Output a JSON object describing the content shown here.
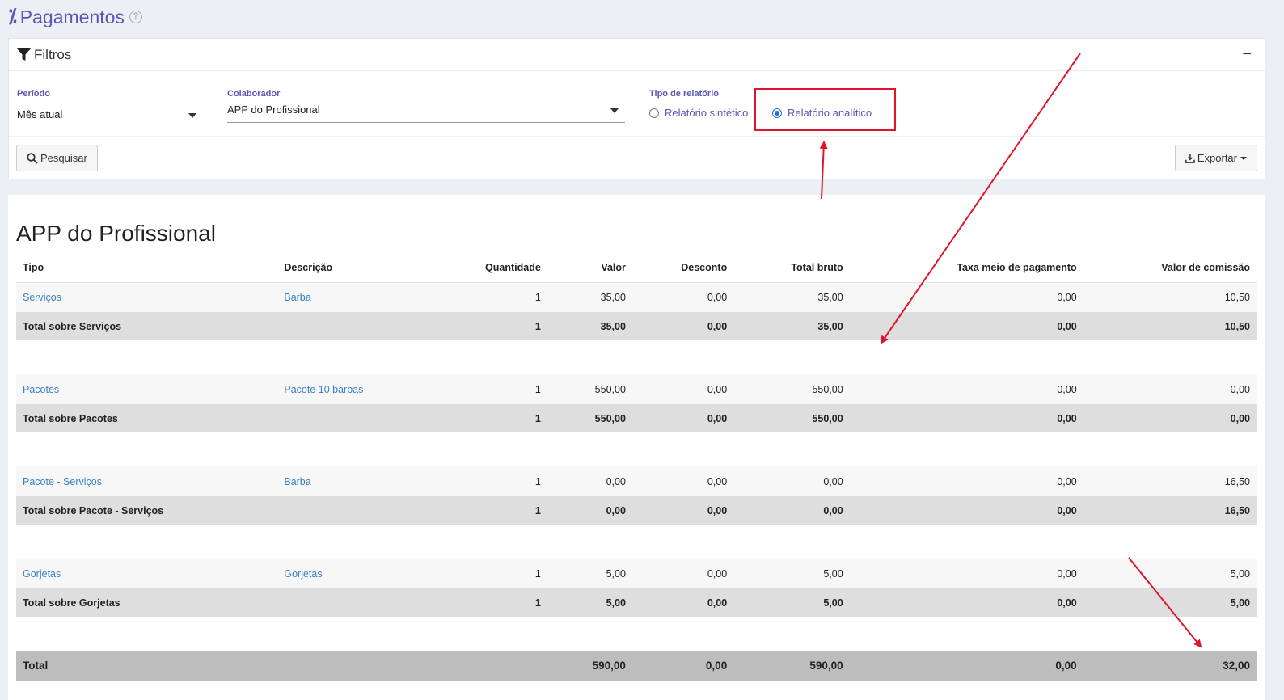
{
  "page": {
    "title": "Pagamentos",
    "help_glyph": "?"
  },
  "filters": {
    "title": "Filtros",
    "collapse_glyph": "−",
    "periodo": {
      "label": "Período",
      "value": "Mês atual"
    },
    "colaborador": {
      "label": "Colaborador",
      "value": "APP do Profissional"
    },
    "tipo_relatorio": {
      "label": "Tipo de relatório",
      "options": [
        {
          "label": "Relatório sintético",
          "checked": false
        },
        {
          "label": "Relatório analítico",
          "checked": true
        }
      ]
    },
    "search_label": "Pesquisar",
    "export_label": "Exportar"
  },
  "report": {
    "title": "APP do Profissional",
    "columns": [
      "Tipo",
      "Descrição",
      "Quantidade",
      "Valor",
      "Desconto",
      "Total bruto",
      "Taxa meio de pagamento",
      "Valor de comissão"
    ],
    "groups": [
      {
        "item": [
          "Serviços",
          "Barba",
          "1",
          "35,00",
          "0,00",
          "35,00",
          "0,00",
          "10,50"
        ],
        "total": [
          "Total sobre Serviços",
          "",
          "1",
          "35,00",
          "0,00",
          "35,00",
          "0,00",
          "10,50"
        ]
      },
      {
        "item": [
          "Pacotes",
          "Pacote 10 barbas",
          "1",
          "550,00",
          "0,00",
          "550,00",
          "0,00",
          "0,00"
        ],
        "total": [
          "Total sobre Pacotes",
          "",
          "1",
          "550,00",
          "0,00",
          "550,00",
          "0,00",
          "0,00"
        ]
      },
      {
        "item": [
          "Pacote - Serviços",
          "Barba",
          "1",
          "0,00",
          "0,00",
          "0,00",
          "0,00",
          "16,50"
        ],
        "total": [
          "Total sobre Pacote - Serviços",
          "",
          "1",
          "0,00",
          "0,00",
          "0,00",
          "0,00",
          "16,50"
        ]
      },
      {
        "item": [
          "Gorjetas",
          "Gorjetas",
          "1",
          "5,00",
          "0,00",
          "5,00",
          "0,00",
          "5,00"
        ],
        "total": [
          "Total sobre Gorjetas",
          "",
          "1",
          "5,00",
          "0,00",
          "5,00",
          "0,00",
          "5,00"
        ]
      }
    ],
    "grand_total": [
      "Total",
      "",
      "",
      "590,00",
      "0,00",
      "590,00",
      "0,00",
      "32,00"
    ]
  },
  "colors": {
    "accent": "#5b56b6",
    "link": "#3b82c4",
    "annotation": "#e0142c"
  }
}
